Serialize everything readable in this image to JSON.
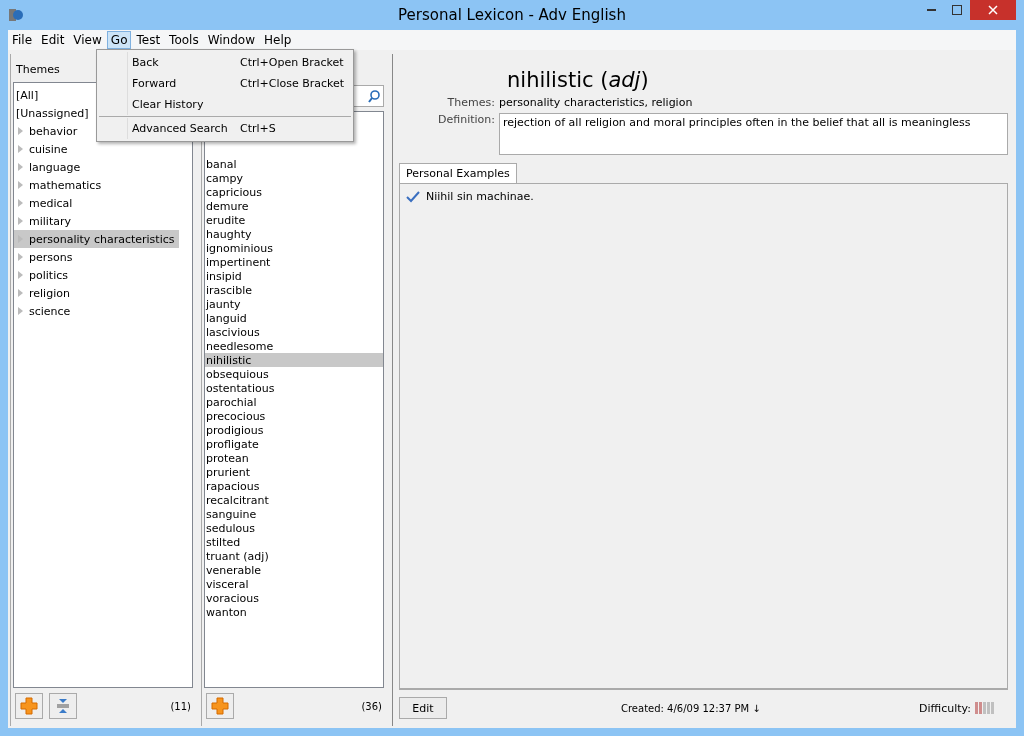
{
  "window": {
    "title": "Personal Lexicon - Adv English"
  },
  "menu": [
    {
      "label": "File",
      "selected": false
    },
    {
      "label": "Edit",
      "selected": false
    },
    {
      "label": "View",
      "selected": false
    },
    {
      "label": "Go",
      "selected": true
    },
    {
      "label": "Test",
      "selected": false
    },
    {
      "label": "Tools",
      "selected": false
    },
    {
      "label": "Window",
      "selected": false
    },
    {
      "label": "Help",
      "selected": false
    }
  ],
  "dropdown": [
    {
      "kind": "item",
      "label": "Back",
      "shortcut": "Ctrl+Open Bracket"
    },
    {
      "kind": "item",
      "label": "Forward",
      "shortcut": "Ctrl+Close Bracket"
    },
    {
      "kind": "item",
      "label": "Clear History"
    },
    {
      "kind": "separator"
    },
    {
      "kind": "item",
      "label": "Advanced Search",
      "shortcut": "Ctrl+S"
    }
  ],
  "themes": {
    "title": "Themes",
    "count": "(11)",
    "items": [
      {
        "label": "[All]",
        "expandable": false,
        "selected": false
      },
      {
        "label": "[Unassigned]",
        "expandable": false,
        "selected": false
      },
      {
        "label": "behavior",
        "expandable": true,
        "selected": false
      },
      {
        "label": "cuisine",
        "expandable": true,
        "selected": false
      },
      {
        "label": "language",
        "expandable": true,
        "selected": false
      },
      {
        "label": "mathematics",
        "expandable": true,
        "selected": false
      },
      {
        "label": "medical",
        "expandable": true,
        "selected": false
      },
      {
        "label": "military",
        "expandable": true,
        "selected": false
      },
      {
        "label": "personality characteristics",
        "expandable": true,
        "selected": true
      },
      {
        "label": "persons",
        "expandable": true,
        "selected": false
      },
      {
        "label": "politics",
        "expandable": true,
        "selected": false
      },
      {
        "label": "religion",
        "expandable": true,
        "selected": false
      },
      {
        "label": "science",
        "expandable": true,
        "selected": false
      }
    ]
  },
  "words": {
    "count": "(36)",
    "items": [
      {
        "label": "banal",
        "selected": false
      },
      {
        "label": "campy",
        "selected": false
      },
      {
        "label": "capricious",
        "selected": false
      },
      {
        "label": "demure",
        "selected": false
      },
      {
        "label": "erudite",
        "selected": false
      },
      {
        "label": "haughty",
        "selected": false
      },
      {
        "label": "ignominious",
        "selected": false
      },
      {
        "label": "impertinent",
        "selected": false
      },
      {
        "label": "insipid",
        "selected": false
      },
      {
        "label": "irascible",
        "selected": false
      },
      {
        "label": "jaunty",
        "selected": false
      },
      {
        "label": "languid",
        "selected": false
      },
      {
        "label": "lascivious",
        "selected": false
      },
      {
        "label": "needlesome",
        "selected": false
      },
      {
        "label": "nihilistic",
        "selected": true
      },
      {
        "label": "obsequious",
        "selected": false
      },
      {
        "label": "ostentatious",
        "selected": false
      },
      {
        "label": "parochial",
        "selected": false
      },
      {
        "label": "precocious",
        "selected": false
      },
      {
        "label": "prodigious",
        "selected": false
      },
      {
        "label": "profligate",
        "selected": false
      },
      {
        "label": "protean",
        "selected": false
      },
      {
        "label": "prurient",
        "selected": false
      },
      {
        "label": "rapacious",
        "selected": false
      },
      {
        "label": "recalcitrant",
        "selected": false
      },
      {
        "label": "sanguine",
        "selected": false
      },
      {
        "label": "sedulous",
        "selected": false
      },
      {
        "label": "stilted",
        "selected": false
      },
      {
        "label": "truant (adj)",
        "selected": false
      },
      {
        "label": "venerable",
        "selected": false
      },
      {
        "label": "visceral",
        "selected": false
      },
      {
        "label": "voracious",
        "selected": false
      },
      {
        "label": "wanton",
        "selected": false
      }
    ]
  },
  "entry": {
    "heading": "nihilistic (*adj*)",
    "themes_label": "Themes:",
    "themes": "personality characteristics, religion",
    "definition_label": "Definition:",
    "definition": "rejection of all religion and moral principles often in the belief that all is meaningless",
    "tabs": [
      {
        "label": "Personal Examples",
        "selected": true
      }
    ],
    "examples": [
      {
        "text": "Niihil sin machinae.",
        "checked": true
      }
    ]
  },
  "footer": {
    "edit": "Edit",
    "created": "Created: 4/6/09 12:37 PM ↓",
    "difficulty_label": "Difficulty:",
    "difficulty": {
      "level": 0.4
    }
  }
}
